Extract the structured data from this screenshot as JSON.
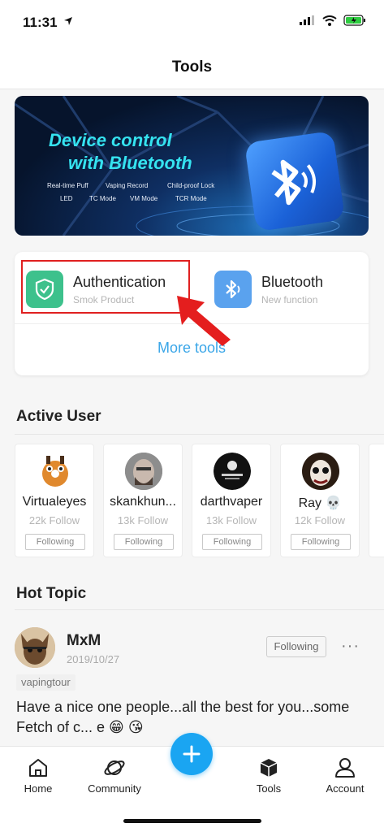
{
  "status": {
    "time": "11:31"
  },
  "nav": {
    "title": "Tools"
  },
  "banner": {
    "title_line1": "Device control",
    "title_line2": "with Bluetooth",
    "features_row1": [
      "Real-time Puff",
      "Vaping Record",
      "Child-proof Lock"
    ],
    "features_row2": [
      "LED",
      "TC Mode",
      "VM Mode",
      "TCR Mode"
    ]
  },
  "tools": {
    "items": [
      {
        "name": "Authentication",
        "sub": "Smok Product",
        "icon": "shield-check-icon",
        "color": "#3dc18c"
      },
      {
        "name": "Bluetooth",
        "sub": "New function",
        "icon": "bluetooth-icon",
        "color": "#5aa2ee"
      }
    ],
    "more": "More tools"
  },
  "active_user": {
    "title": "Active User",
    "users": [
      {
        "name": "Virtualeyes",
        "follow": "22k Follow",
        "button": "Following"
      },
      {
        "name": "skankhun...",
        "follow": "13k Follow",
        "button": "Following"
      },
      {
        "name": "darthvaper",
        "follow": "13k Follow",
        "button": "Following"
      },
      {
        "name": "Ray 💀",
        "follow": "12k Follow",
        "button": "Following"
      }
    ]
  },
  "hot_topic": {
    "title": "Hot Topic",
    "post": {
      "author": "MxM",
      "date": "2019/10/27",
      "follow_button": "Following",
      "more": "···",
      "tag": "vapingtour",
      "body": "Have a nice one people...all the best for you...some Fetch of c... e 😁 😘"
    }
  },
  "tabbar": {
    "items": [
      {
        "label": "Home",
        "icon": "home-icon"
      },
      {
        "label": "Community",
        "icon": "planet-icon"
      },
      {
        "label": "Tools",
        "icon": "cube-icon"
      },
      {
        "label": "Account",
        "icon": "person-icon"
      }
    ],
    "add": "+"
  },
  "colors": {
    "accent": "#1aa5f2",
    "link": "#3aa6e8",
    "highlight": "#e02020"
  }
}
